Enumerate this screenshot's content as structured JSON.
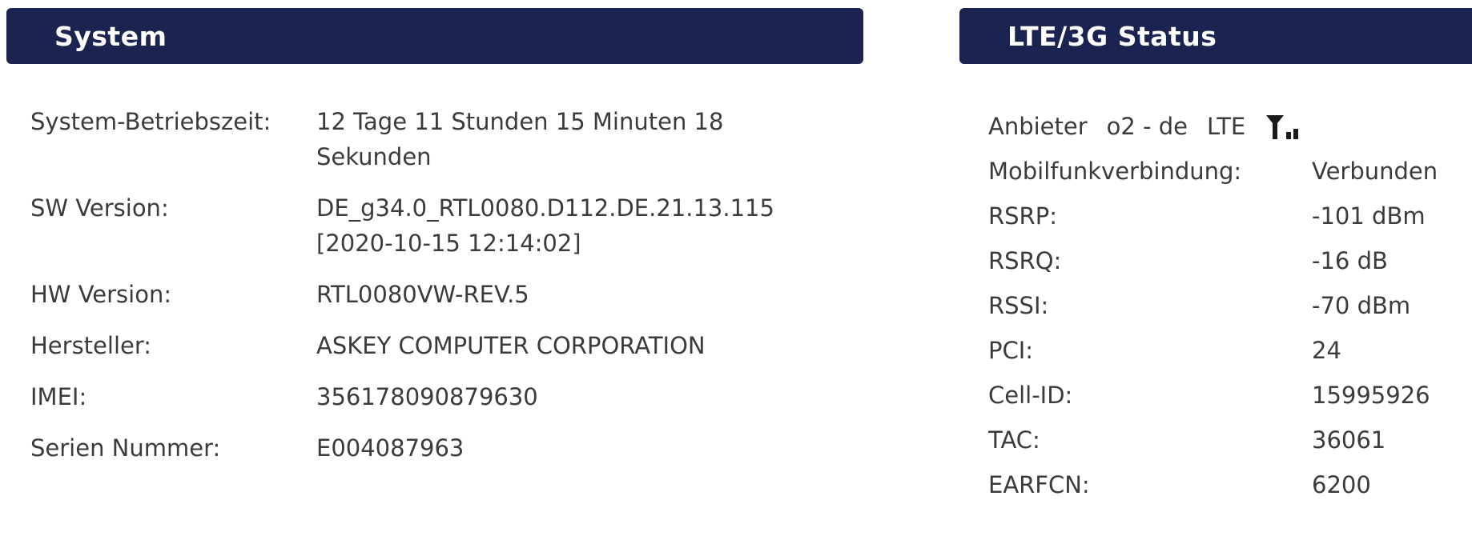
{
  "system": {
    "title": "System",
    "rows": [
      {
        "label": "System-Betriebszeit:",
        "value": "12 Tage 11 Stunden 15 Minuten 18 Sekunden"
      },
      {
        "label": "SW Version:",
        "value": "DE_g34.0_RTL0080.D112.DE.21.13.115 [2020-10-15 12:14:02]"
      },
      {
        "label": "HW Version:",
        "value": "RTL0080VW-REV.5"
      },
      {
        "label": "Hersteller:",
        "value": "ASKEY COMPUTER CORPORATION"
      },
      {
        "label": "IMEI:",
        "value": "356178090879630"
      },
      {
        "label": "Serien Nummer:",
        "value": "E004087963"
      }
    ]
  },
  "lte": {
    "title": "LTE/3G Status",
    "provider_label": "Anbieter",
    "provider_value": "o2 - de",
    "network_type": "LTE",
    "signal_icon": "antenna-signal-icon",
    "rows": [
      {
        "label": "Mobilfunkverbindung:",
        "value": "Verbunden"
      },
      {
        "label": "RSRP:",
        "value": "-101 dBm"
      },
      {
        "label": "RSRQ:",
        "value": "-16 dB"
      },
      {
        "label": "RSSI:",
        "value": "-70 dBm"
      },
      {
        "label": "PCI:",
        "value": "24"
      },
      {
        "label": "Cell-ID:",
        "value": "15995926"
      },
      {
        "label": "TAC:",
        "value": "36061"
      },
      {
        "label": "EARFCN:",
        "value": "6200"
      }
    ]
  },
  "colors": {
    "header_bg": "#1b2350",
    "header_text": "#ffffff",
    "body_text": "#3b3b3b"
  }
}
